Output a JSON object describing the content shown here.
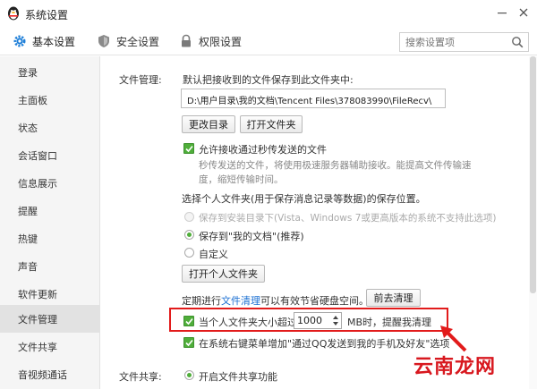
{
  "window": {
    "title": "系统设置"
  },
  "nav": {
    "tabs": [
      {
        "label": "基本设置"
      },
      {
        "label": "安全设置"
      },
      {
        "label": "权限设置"
      }
    ],
    "search_placeholder": "搜索设置项"
  },
  "sidebar": {
    "items": [
      {
        "label": "登录"
      },
      {
        "label": "主面板"
      },
      {
        "label": "状态"
      },
      {
        "label": "会话窗口"
      },
      {
        "label": "信息展示"
      },
      {
        "label": "提醒"
      },
      {
        "label": "热键"
      },
      {
        "label": "声音"
      },
      {
        "label": "软件更新"
      },
      {
        "label": "文件管理"
      },
      {
        "label": "文件共享"
      },
      {
        "label": "音视频通话"
      }
    ]
  },
  "file_management": {
    "section_label": "文件管理:",
    "default_save_text": "默认把接收到的文件保存到此文件夹中:",
    "path": "D:\\用户目录\\我的文档\\Tencent Files\\378083990\\FileRecv\\",
    "change_dir_label": "更改目录",
    "open_folder_label": "打开文件夹",
    "allow_instant_label": "允许接收通过秒传发送的文件",
    "instant_desc_1": "秒传发送的文件，将使用极速服务器辅助接收。能提高文件传输速",
    "instant_desc_2": "度，缩短传输时间。",
    "personal_folder_title": "选择个人文件夹(用于保存消息记录等数据)的保存位置。",
    "option_install_dir": "保存到安装目录下(Vista、Windows 7或更高版本的系统不支持此选项)",
    "option_my_docs": "保存到\"我的文档\"(推荐)",
    "option_custom": "自定义",
    "open_personal_label": "打开个人文件夹",
    "cleanup_prefix": "定期进行",
    "cleanup_link": "文件清理",
    "cleanup_suffix": "可以有效节省硬盘空间。",
    "cleanup_button": "前去清理",
    "size_limit_prefix": "当个人文件夹大小超过",
    "size_limit_value": "1000",
    "size_limit_suffix": "MB时，提醒我清理",
    "context_menu_label": "在系统右键菜单增加\"通过QQ发送到我的手机及好友\"选项"
  },
  "file_sharing": {
    "section_label": "文件共享:",
    "enable_label": "开启文件共享功能"
  },
  "watermark": "云南龙网",
  "colors": {
    "accent_green": "#4fae3a",
    "highlight_red": "#e21b1b",
    "link_blue": "#1a6fd2",
    "watermark_red": "#d8181f"
  }
}
